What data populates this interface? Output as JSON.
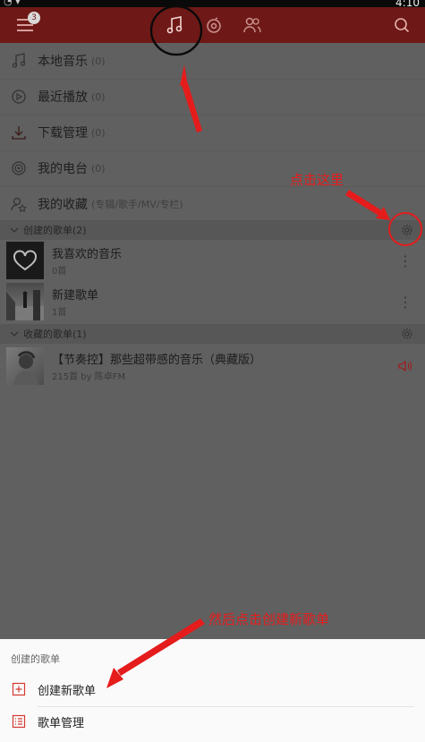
{
  "status_bar": {
    "time": "4:10"
  },
  "top_nav": {
    "badge": "3"
  },
  "menu": [
    {
      "label": "本地音乐",
      "count": "(0)",
      "icon": "music-note-icon"
    },
    {
      "label": "最近播放",
      "count": "(0)",
      "icon": "recent-play-icon"
    },
    {
      "label": "下载管理",
      "count": "(0)",
      "icon": "download-icon"
    },
    {
      "label": "我的电台",
      "count": "(0)",
      "icon": "radio-icon"
    },
    {
      "label": "我的收藏",
      "count": "(专辑/歌手/MV/专栏)",
      "icon": "collection-icon"
    }
  ],
  "created_section": {
    "label": "创建的歌单(2)"
  },
  "created_playlists": [
    {
      "name": "我喜欢的音乐",
      "sub": "0首"
    },
    {
      "name": "新建歌单",
      "sub": "1首"
    }
  ],
  "collected_section": {
    "label": "收藏的歌单(1)"
  },
  "collected_playlists": [
    {
      "name": "【节奏控】那些超带感的音乐（典藏版）",
      "sub": "215首 by 陈卓FM"
    }
  ],
  "annotations": {
    "click_here": "点击这里",
    "then_click": "然后点击创建新歌单"
  },
  "sheet": {
    "title": "创建的歌单",
    "items": [
      {
        "label": "创建新歌单",
        "icon": "add-box-icon"
      },
      {
        "label": "歌单管理",
        "icon": "list-manage-icon"
      }
    ]
  },
  "colors": {
    "brand_dim": "#6e1917",
    "annotation": "#e51c1c",
    "overlay": "#606060"
  }
}
